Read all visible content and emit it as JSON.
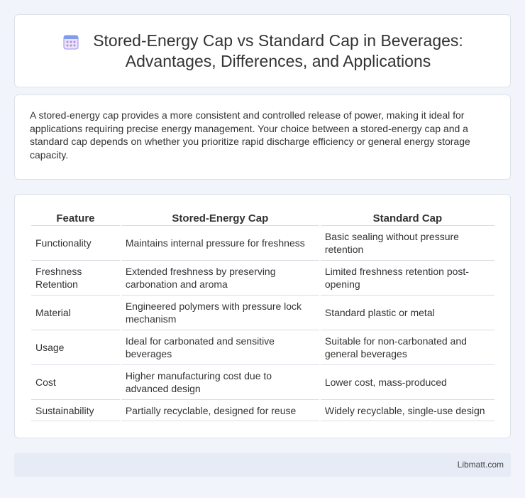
{
  "header": {
    "icon": "calendar-icon",
    "title": "Stored-Energy Cap vs Standard Cap in Beverages: Advantages, Differences, and Applications"
  },
  "intro": {
    "text": "A stored-energy cap provides a more consistent and controlled release of power, making it ideal for applications requiring precise energy management. Your choice between a stored-energy cap and a standard cap depends on whether you prioritize rapid discharge efficiency or general energy storage capacity."
  },
  "table": {
    "headers": [
      "Feature",
      "Stored-Energy Cap",
      "Standard Cap"
    ],
    "rows": [
      [
        "Functionality",
        "Maintains internal pressure for freshness",
        "Basic sealing without pressure retention"
      ],
      [
        "Freshness Retention",
        "Extended freshness by preserving carbonation and aroma",
        "Limited freshness retention post-opening"
      ],
      [
        "Material",
        "Engineered polymers with pressure lock mechanism",
        "Standard plastic or metal"
      ],
      [
        "Usage",
        "Ideal for carbonated and sensitive beverages",
        "Suitable for non-carbonated and general beverages"
      ],
      [
        "Cost",
        "Higher manufacturing cost due to advanced design",
        "Lower cost, mass-produced"
      ],
      [
        "Sustainability",
        "Partially recyclable, designed for reuse",
        "Widely recyclable, single-use design"
      ]
    ]
  },
  "footer": {
    "brand": "Libmatt.com"
  },
  "colors": {
    "background": "#f1f4fa",
    "card": "#ffffff",
    "footer": "#e6ebf5",
    "icon_accent": "#8a7be0"
  }
}
